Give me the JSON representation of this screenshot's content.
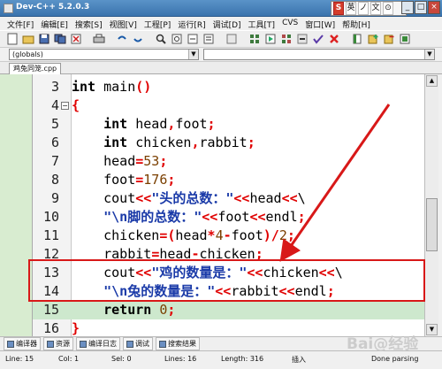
{
  "window": {
    "title": "Dev-C++ 5.2.0.3"
  },
  "ime": {
    "items": [
      "S",
      "英",
      "ノ",
      "文",
      "⊙"
    ]
  },
  "window_buttons": {
    "minimize": "_",
    "maximize": "□",
    "close": "×"
  },
  "menu": [
    "文件[F]",
    "编辑[E]",
    "搜索[S]",
    "视图[V]",
    "工程[P]",
    "运行[R]",
    "调试[D]",
    "工具[T]",
    "CVS",
    "窗口[W]",
    "帮助[H]"
  ],
  "toolbar_icons": [
    "new-icon",
    "open-icon",
    "save-icon",
    "save-all-icon",
    "close-icon",
    "print-icon",
    "undo-icon",
    "redo-icon",
    "find-icon",
    "replace-icon",
    "find-next-icon",
    "goto-icon",
    "indent-icon",
    "unindent-icon",
    "compile-icon",
    "run-icon",
    "compile-run-icon",
    "rebuild-icon",
    "check-icon",
    "stop-icon",
    "new-project-icon",
    "add-file-icon",
    "remove-file-icon",
    "options-icon"
  ],
  "scope": {
    "value": "(globals)"
  },
  "member": {
    "value": ""
  },
  "tab": {
    "label": "鸡兔同笼.cpp"
  },
  "code_lines": [
    {
      "n": "3",
      "t": "int main()"
    },
    {
      "n": "4",
      "t": "{"
    },
    {
      "n": "5",
      "t": "    int head,foot;"
    },
    {
      "n": "6",
      "t": "    int chicken,rabbit;"
    },
    {
      "n": "7",
      "t": "    head=53;"
    },
    {
      "n": "8",
      "t": "    foot=176;"
    },
    {
      "n": "9",
      "t": "    cout<<\"头的总数：\"<<head<<\\"
    },
    {
      "n": "10",
      "t": "    \"\\n脚的总数：\"<<foot<<endl;"
    },
    {
      "n": "11",
      "t": "    chicken=(head*4-foot)/2;"
    },
    {
      "n": "12",
      "t": "    rabbit=head-chicken;"
    },
    {
      "n": "13",
      "t": "    cout<<\"鸡的数量是：\"<<chicken<<\\"
    },
    {
      "n": "14",
      "t": "    \"\\n兔的数量是：\"<<rabbit<<endl;"
    },
    {
      "n": "15",
      "t": "    return 0;"
    },
    {
      "n": "16",
      "t": "}"
    }
  ],
  "bottom_tabs": [
    "编译器",
    "资源",
    "编译日志",
    "调试",
    "搜索结果"
  ],
  "status": {
    "line_label": "Line:",
    "line": "15",
    "col_label": "Col:",
    "col": "1",
    "sel_label": "Sel:",
    "sel": "0",
    "lines_label": "Lines:",
    "lines": "16",
    "length_label": "Length:",
    "length": "316",
    "mode": "插入",
    "message": "Done parsing"
  },
  "watermark": "Bai@经验",
  "colors": {
    "annotation_red": "#d81818",
    "highlight_row": "#cde8cd",
    "string_blue": "#1a3aa8",
    "operator_red": "#e00000"
  }
}
